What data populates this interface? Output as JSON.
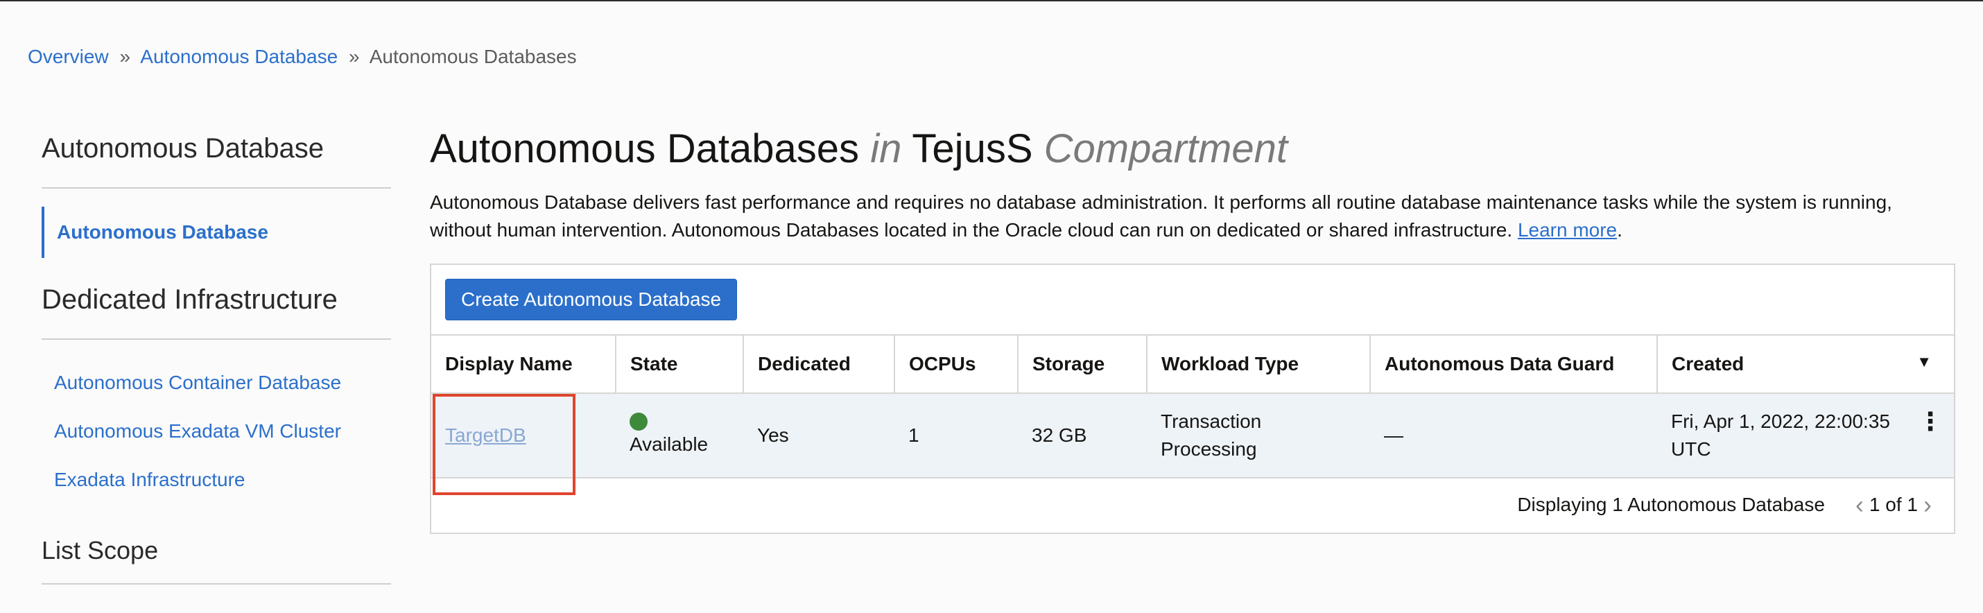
{
  "breadcrumb": {
    "items": [
      "Overview",
      "Autonomous Database",
      "Autonomous Databases"
    ],
    "separator": "»"
  },
  "sidebar": {
    "section1_title": "Autonomous Database",
    "section1_items": [
      "Autonomous Database"
    ],
    "section2_title": "Dedicated Infrastructure",
    "section2_items": [
      "Autonomous Container Database",
      "Autonomous Exadata VM Cluster",
      "Exadata Infrastructure"
    ],
    "section3_title": "List Scope"
  },
  "main": {
    "title": "Autonomous Databases",
    "title_in": "in",
    "compartment": "TejusS",
    "compartment_word": "Compartment",
    "description": "Autonomous Database delivers fast performance and requires no database administration. It performs all routine database maintenance tasks while the system is running, without human intervention. Autonomous Databases located in the Oracle cloud can run on dedicated or shared infrastructure.",
    "learn_more": "Learn more",
    "period": ".",
    "create_button": "Create Autonomous Database"
  },
  "table": {
    "columns": [
      "Display Name",
      "State",
      "Dedicated",
      "OCPUs",
      "Storage",
      "Workload Type",
      "Autonomous Data Guard",
      "Created"
    ],
    "sort_indicator": "▼",
    "rows": [
      {
        "display_name": "TargetDB",
        "state": "Available",
        "dedicated": "Yes",
        "ocpus": "1",
        "storage": "32 GB",
        "workload_type": "Transaction Processing",
        "data_guard": "—",
        "created": "Fri, Apr 1, 2022, 22:00:35 UTC",
        "actions": "⋮"
      }
    ]
  },
  "footer": {
    "displaying": "Displaying 1 Autonomous Database",
    "page": "1 of 1",
    "prev": "‹",
    "next": "›"
  },
  "colors": {
    "link": "#2b6fcb",
    "button": "#2b6fcb",
    "status_available": "#3c8a3a",
    "highlight": "#e0452e"
  }
}
